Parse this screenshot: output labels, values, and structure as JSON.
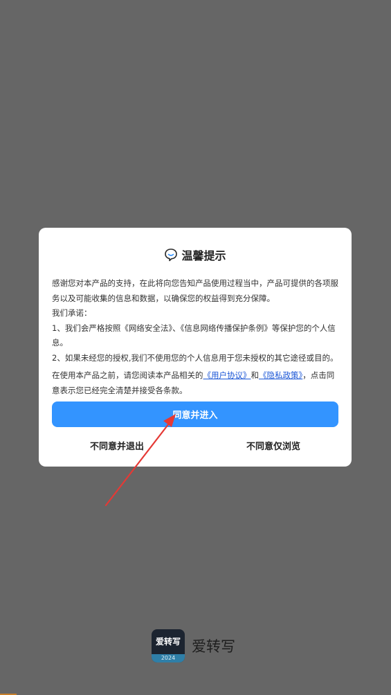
{
  "dialog": {
    "title": "温馨提示",
    "title_icon": "chat-bubble-icon",
    "intro": "感谢您对本产品的支持，在此将向您告知产品使用过程当中，产品可提供的各项服务以及可能收集的信息和数据，以确保您的权益得到充分保障。",
    "promise_heading": "我们承诺：",
    "promise_1": "1、我们会严格按照《网络安全法》、《信息网络传播保护条例》等保护您的个人信息。",
    "promise_2": "2、如果未经您的授权,我们不使用您的个人信息用于您未授权的其它途径或目的。",
    "notice_before": "在使用本产品之前，请您阅读本产品相关的",
    "user_agreement_link": "《用户协议》",
    "and_text": "和",
    "privacy_policy_link": "《隐私政策》",
    "notice_after": "，点击同意表示您已经完全清楚并接受各条款。",
    "agree_button": "同意并进入",
    "disagree_exit_button": "不同意并退出",
    "disagree_browse_button": "不同意仅浏览"
  },
  "brand": {
    "icon_text": "爱转写",
    "icon_year": "2024",
    "app_name": "爱转写"
  },
  "colors": {
    "backdrop": "#666666",
    "primary_button": "#3394ff",
    "link": "#1a56d6",
    "annotation_arrow": "#e53935"
  }
}
